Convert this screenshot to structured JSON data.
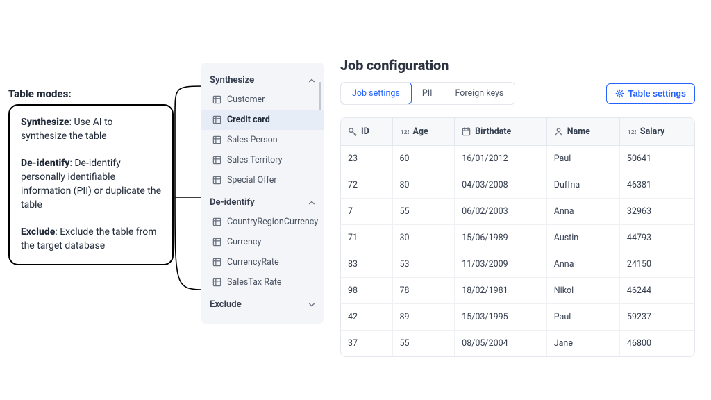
{
  "annotation": {
    "title": "Table modes:",
    "items": [
      {
        "name": "Synthesize",
        "desc": "Use AI to synthesize the table"
      },
      {
        "name": "De-identify",
        "desc": "De-identify personally identifiable information (PII) or duplicate the table"
      },
      {
        "name": "Exclude",
        "desc": "Exclude the table from the target database"
      }
    ]
  },
  "sidebar": {
    "sections": [
      {
        "title": "Synthesize",
        "expanded": true,
        "items": [
          {
            "label": "Customer"
          },
          {
            "label": "Credit card",
            "selected": true
          },
          {
            "label": "Sales Person"
          },
          {
            "label": "Sales Territory"
          },
          {
            "label": "Special Offer"
          }
        ]
      },
      {
        "title": "De-identify",
        "expanded": true,
        "items": [
          {
            "label": "CountryRegionCurrency"
          },
          {
            "label": "Currency"
          },
          {
            "label": "CurrencyRate"
          },
          {
            "label": "SalesTax Rate"
          }
        ]
      },
      {
        "title": "Exclude",
        "expanded": false,
        "items": []
      }
    ]
  },
  "main": {
    "heading": "Job configuration",
    "tabs": [
      {
        "label": "Job settings",
        "active": true
      },
      {
        "label": "PII"
      },
      {
        "label": "Foreign keys"
      }
    ],
    "settings_btn": "Table settings",
    "columns": [
      {
        "icon": "key",
        "label": "ID"
      },
      {
        "icon": "numbers",
        "label": "Age"
      },
      {
        "icon": "calendar",
        "label": "Birthdate"
      },
      {
        "icon": "person",
        "label": "Name"
      },
      {
        "icon": "numbers",
        "label": "Salary"
      }
    ],
    "rows": [
      {
        "id": "23",
        "age": "60",
        "birthdate": "16/01/2012",
        "name": "Paul",
        "salary": "50641"
      },
      {
        "id": "72",
        "age": "80",
        "birthdate": "04/03/2008",
        "name": "Duffna",
        "salary": "46381"
      },
      {
        "id": "7",
        "age": "55",
        "birthdate": "06/02/2003",
        "name": "Anna",
        "salary": "32963"
      },
      {
        "id": "71",
        "age": "30",
        "birthdate": "15/06/1989",
        "name": "Austin",
        "salary": "44793"
      },
      {
        "id": "83",
        "age": "53",
        "birthdate": "11/03/2009",
        "name": "Anna",
        "salary": "24150"
      },
      {
        "id": "98",
        "age": "78",
        "birthdate": "18/02/1981",
        "name": "Nikol",
        "salary": "46244"
      },
      {
        "id": "42",
        "age": "89",
        "birthdate": "15/03/1995",
        "name": "Paul",
        "salary": "59237"
      },
      {
        "id": "37",
        "age": "55",
        "birthdate": "08/05/2004",
        "name": "Jane",
        "salary": "46800"
      }
    ]
  }
}
